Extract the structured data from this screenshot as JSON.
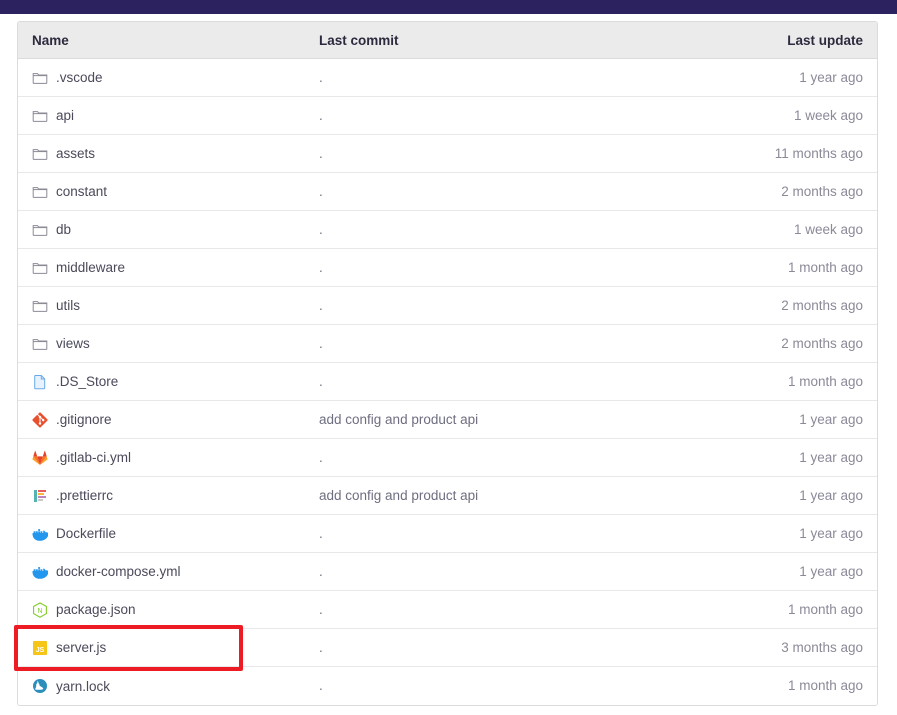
{
  "topbar": {
    "color": "#2c2260"
  },
  "table": {
    "columns": {
      "name": "Name",
      "last_commit": "Last commit",
      "last_update": "Last update"
    },
    "rows": [
      {
        "name": ".vscode",
        "icon": "folder-icon",
        "last_commit": ".",
        "last_update": "1 year ago"
      },
      {
        "name": "api",
        "icon": "folder-icon",
        "last_commit": ".",
        "last_update": "1 week ago"
      },
      {
        "name": "assets",
        "icon": "folder-icon",
        "last_commit": ".",
        "last_update": "11 months ago"
      },
      {
        "name": "constant",
        "icon": "folder-icon",
        "last_commit": ".",
        "last_update": "2 months ago"
      },
      {
        "name": "db",
        "icon": "folder-icon",
        "last_commit": ".",
        "last_update": "1 week ago"
      },
      {
        "name": "middleware",
        "icon": "folder-icon",
        "last_commit": ".",
        "last_update": "1 month ago"
      },
      {
        "name": "utils",
        "icon": "folder-icon",
        "last_commit": ".",
        "last_update": "2 months ago"
      },
      {
        "name": "views",
        "icon": "folder-icon",
        "last_commit": ".",
        "last_update": "2 months ago"
      },
      {
        "name": ".DS_Store",
        "icon": "generic-file-icon",
        "last_commit": ".",
        "last_update": "1 month ago"
      },
      {
        "name": ".gitignore",
        "icon": "git-icon",
        "last_commit": "add config and product api",
        "last_update": "1 year ago"
      },
      {
        "name": ".gitlab-ci.yml",
        "icon": "gitlab-icon",
        "last_commit": ".",
        "last_update": "1 year ago"
      },
      {
        "name": ".prettierrc",
        "icon": "prettier-icon",
        "last_commit": "add config and product api",
        "last_update": "1 year ago"
      },
      {
        "name": "Dockerfile",
        "icon": "docker-icon",
        "last_commit": ".",
        "last_update": "1 year ago"
      },
      {
        "name": "docker-compose.yml",
        "icon": "docker-icon",
        "last_commit": ".",
        "last_update": "1 year ago"
      },
      {
        "name": "package.json",
        "icon": "nodejs-icon",
        "last_commit": ".",
        "last_update": "1 month ago"
      },
      {
        "name": "server.js",
        "icon": "javascript-icon",
        "last_commit": ".",
        "last_update": "3 months ago"
      },
      {
        "name": "yarn.lock",
        "icon": "yarn-icon",
        "last_commit": ".",
        "last_update": "1 month ago"
      }
    ]
  },
  "highlight": {
    "target_row": "server.js",
    "color": "#ed1c24"
  }
}
